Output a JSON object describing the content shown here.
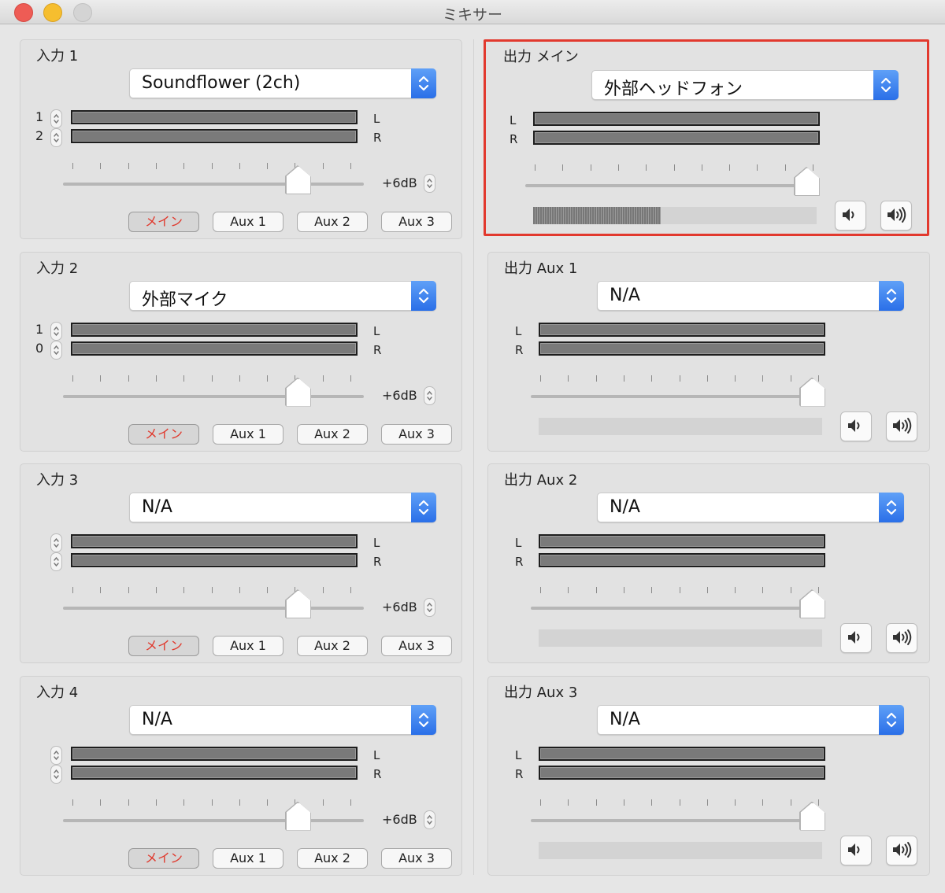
{
  "window": {
    "title": "ミキサー"
  },
  "inputs": [
    {
      "title": "入力 1",
      "device": "Soundflower (2ch)",
      "ch1": "1",
      "ch2": "2",
      "gain": "+6dB",
      "fader": 0.78,
      "routes": [
        "メイン",
        "Aux 1",
        "Aux 2",
        "Aux 3"
      ],
      "active_route": 0
    },
    {
      "title": "入力 2",
      "device": "外部マイク",
      "ch1": "1",
      "ch2": "0",
      "gain": "+6dB",
      "fader": 0.78,
      "routes": [
        "メイン",
        "Aux 1",
        "Aux 2",
        "Aux 3"
      ],
      "active_route": 0
    },
    {
      "title": "入力 3",
      "device": "N/A",
      "ch1": "",
      "ch2": "",
      "gain": "+6dB",
      "fader": 0.78,
      "routes": [
        "メイン",
        "Aux 1",
        "Aux 2",
        "Aux 3"
      ],
      "active_route": 0
    },
    {
      "title": "入力 4",
      "device": "N/A",
      "ch1": "",
      "ch2": "",
      "gain": "+6dB",
      "fader": 0.78,
      "routes": [
        "メイン",
        "Aux 1",
        "Aux 2",
        "Aux 3"
      ],
      "active_route": 0
    }
  ],
  "outputs": [
    {
      "title": "出力 メイン",
      "device": "外部ヘッドフォン",
      "level": 0.45,
      "fader": 0.97,
      "highlighted": true
    },
    {
      "title": "出力 Aux 1",
      "device": "N/A",
      "level": 0,
      "fader": 0.97,
      "highlighted": false
    },
    {
      "title": "出力 Aux 2",
      "device": "N/A",
      "level": 0,
      "fader": 0.97,
      "highlighted": false
    },
    {
      "title": "出力 Aux 3",
      "device": "N/A",
      "level": 0,
      "fader": 0.97,
      "highlighted": false
    }
  ],
  "labels": {
    "left": "L",
    "right": "R"
  },
  "colors": {
    "highlight": "#e2392e",
    "active_route_text": "#e0392d",
    "popup_accent": "#2a6fe8"
  },
  "icons": {
    "volume_down": "speaker-low-icon",
    "volume_up": "speaker-high-icon",
    "popup": "chevron-updown-icon"
  }
}
